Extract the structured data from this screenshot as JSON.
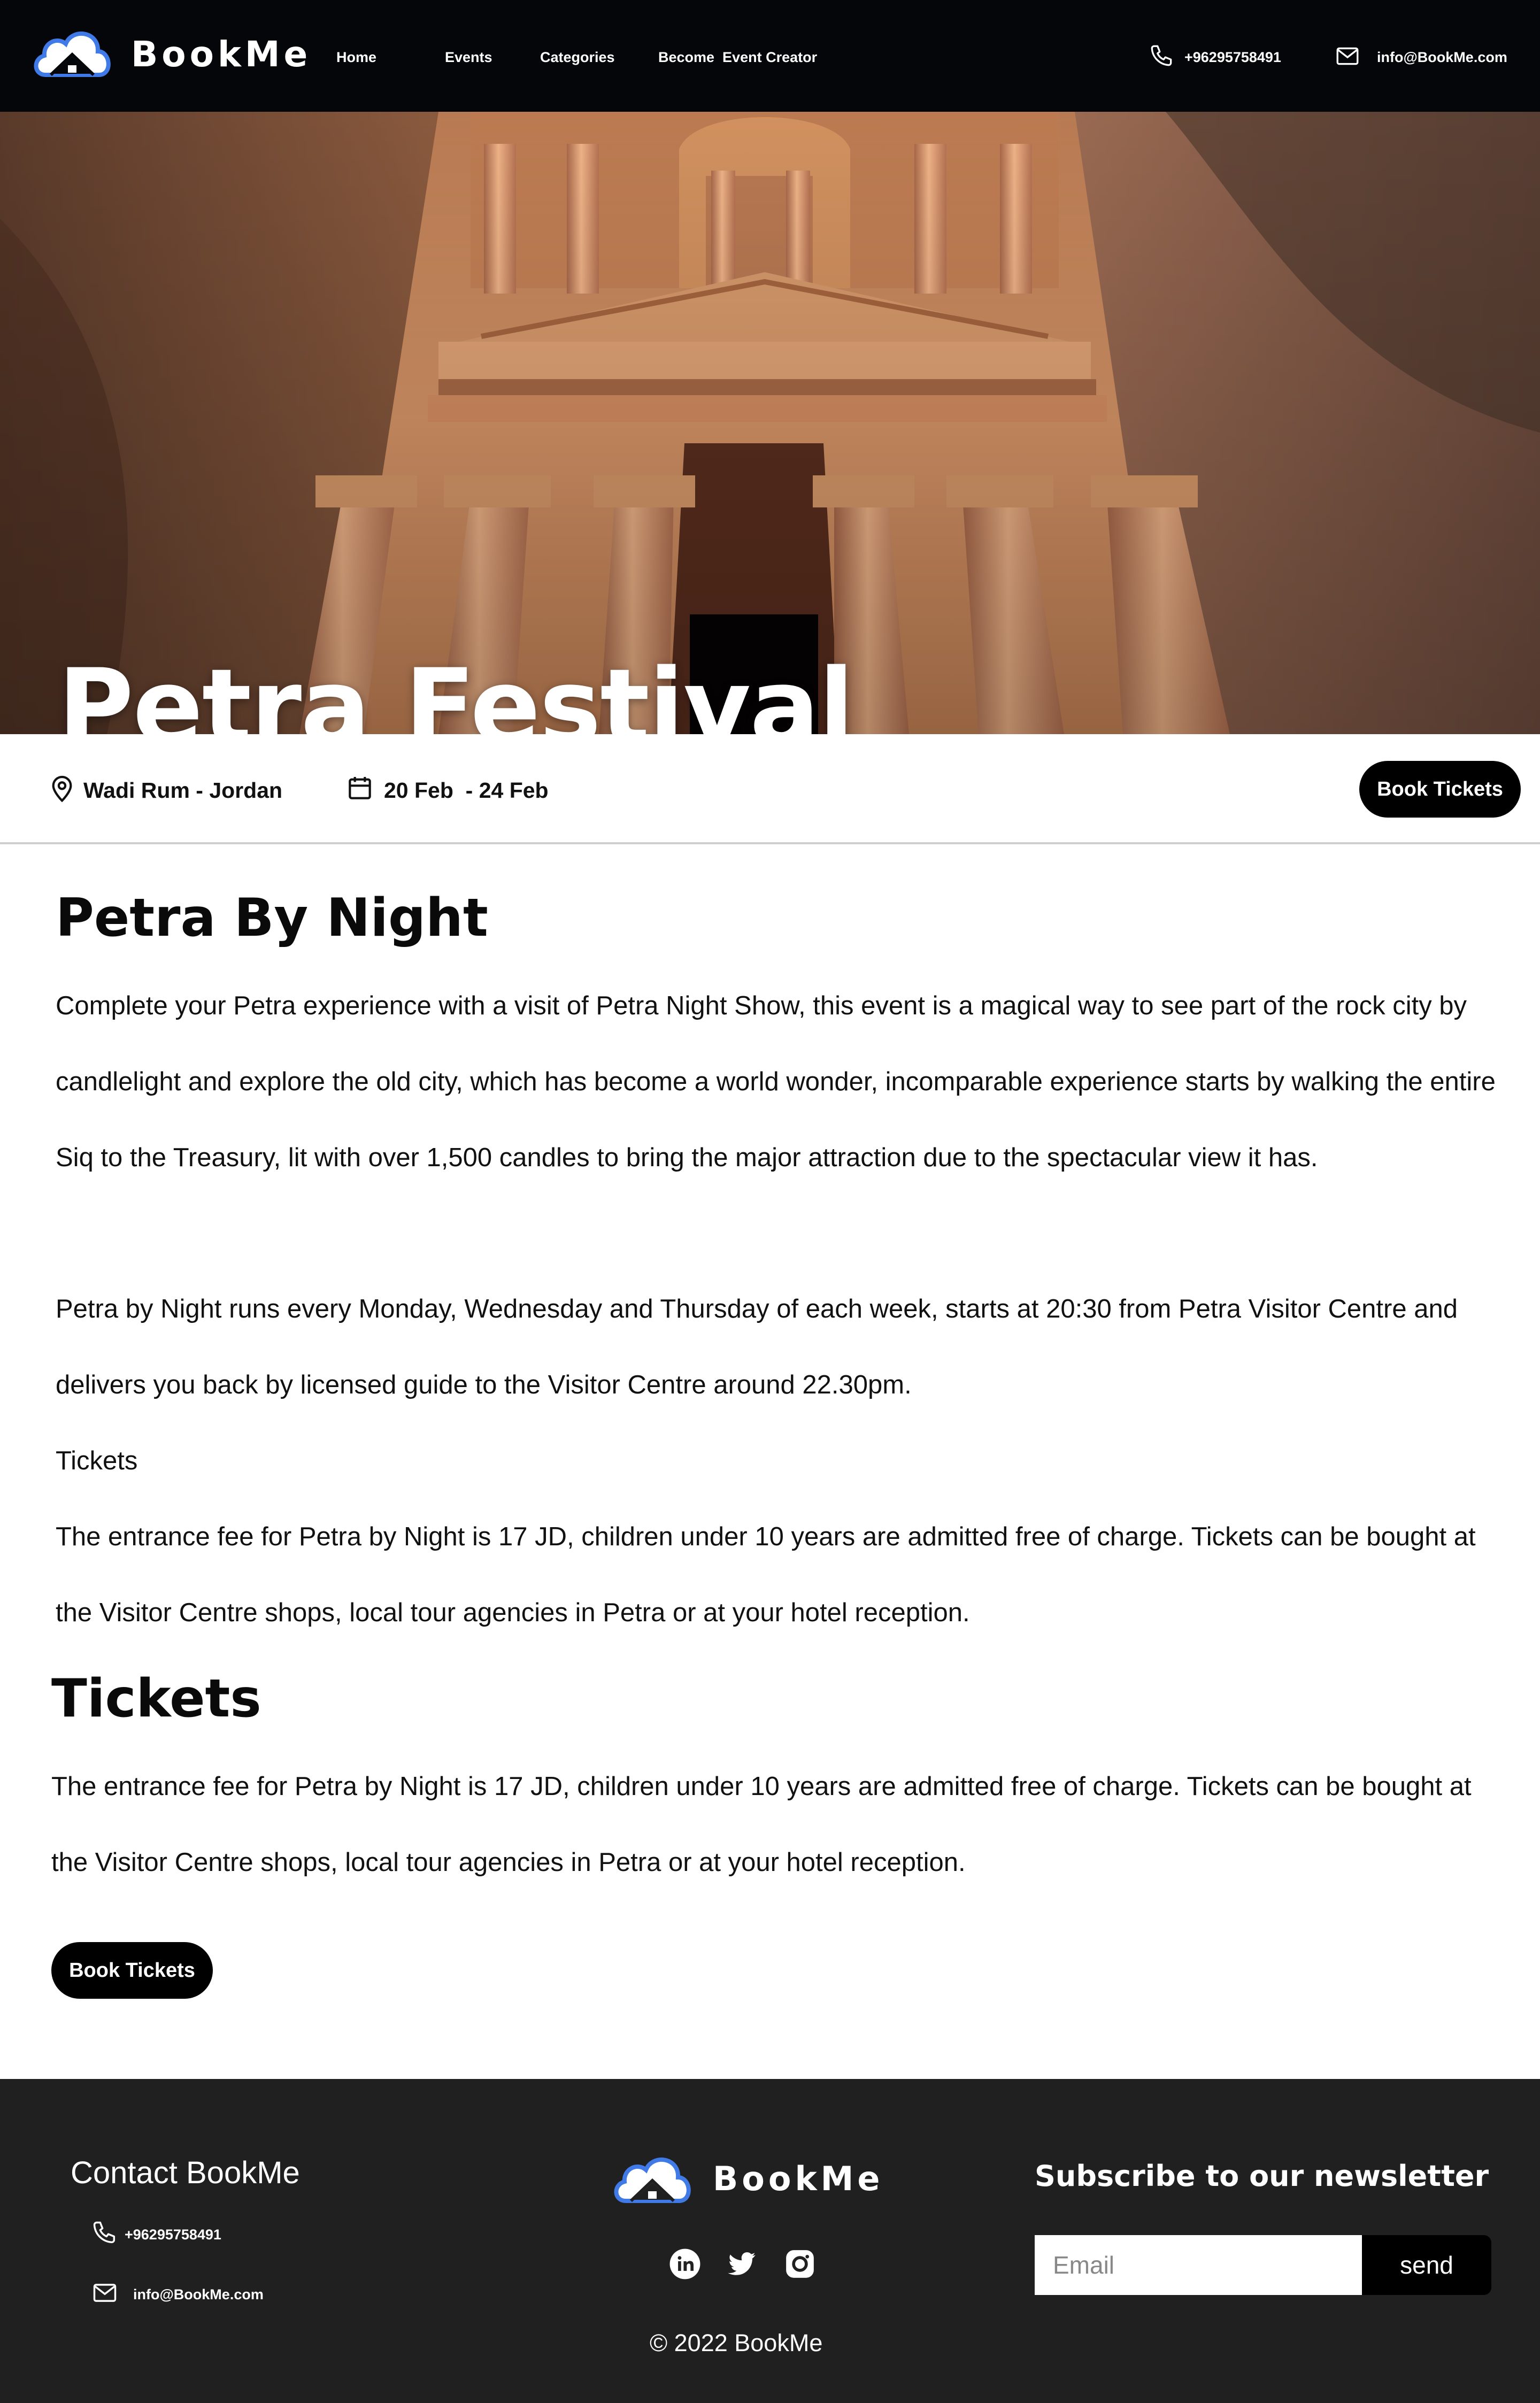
{
  "nav": {
    "brand": "BookMe",
    "links": [
      "Home",
      "Events",
      "Categories",
      "Become  Event Creator"
    ],
    "phone": "+96295758491",
    "email": "info@BookMe.com"
  },
  "hero": {
    "title": "Petra Festival"
  },
  "info": {
    "location": "Wadi Rum - Jordan",
    "dates": "20 Feb  - 24 Feb",
    "book_label": "Book Tickets"
  },
  "about": {
    "heading": "Petra By Night",
    "paragraphs": [
      "Complete your Petra experience with a visit of Petra Night Show, this event is a magical way to see part of the rock city by candlelight and explore the old city, which has become a world wonder, incomparable experience starts by walking the entire Siq to the Treasury, lit with over 1,500 candles to bring the major attraction due to the spectacular view it has.",
      "Petra by Night runs every Monday, Wednesday and Thursday of each week, starts at 20:30 from Petra Visitor Centre and delivers you back by licensed guide to the Visitor Centre around 22.30pm.",
      "Tickets",
      "The entrance fee for Petra by Night is 17 JD, children under 10 years are admitted free of charge. Tickets can be bought at the Visitor Centre shops, local tour agencies in Petra or at your hotel reception."
    ]
  },
  "tickets": {
    "heading": "Tickets",
    "text": "The entrance fee for Petra by Night is 17 JD, children under 10 years are admitted free of charge. Tickets can be bought at the Visitor Centre shops, local tour agencies in Petra or at your hotel reception.",
    "book_label": "Book Tickets"
  },
  "footer": {
    "contact_heading": "Contact BookMe",
    "phone": "+96295758491",
    "email": "info@BookMe.com",
    "brand": "BookMe",
    "social": [
      "linkedin-icon",
      "twitter-icon",
      "instagram-icon"
    ],
    "copyright": "© 2022 BookMe",
    "newsletter_heading": "Subscribe to our newsletter",
    "email_placeholder": "Email",
    "send_label": "send"
  },
  "colors": {
    "navbar_bg": "#05060a",
    "footer_bg": "#202020",
    "button_bg": "#000000",
    "logo_blue": "#3f7ae6"
  }
}
